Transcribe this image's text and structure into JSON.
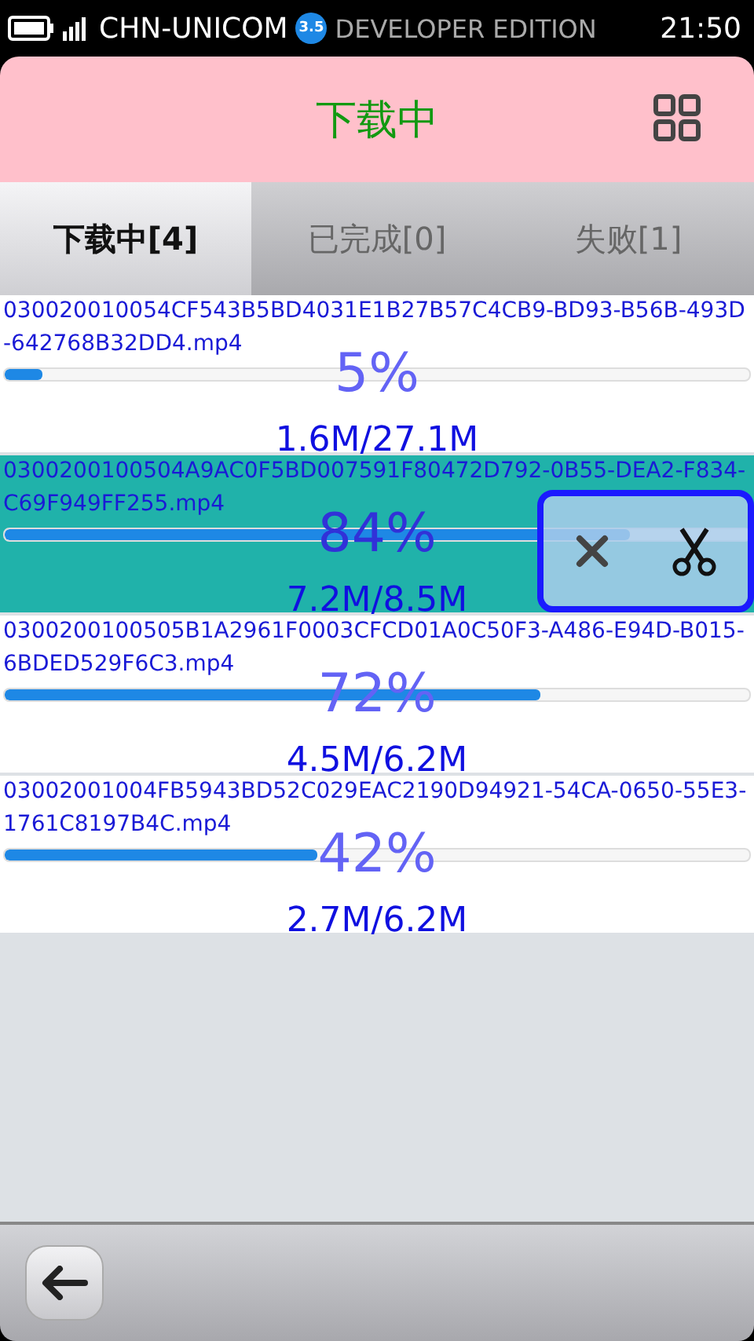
{
  "status_bar": {
    "carrier": "CHN-UNICOM",
    "edition": "DEVELOPER EDITION",
    "version_badge": "3.5",
    "time": "21:50"
  },
  "header": {
    "title": "下载中"
  },
  "tabs": [
    {
      "label": "下载中[4]",
      "selected": true
    },
    {
      "label": "已完成[0]",
      "selected": false
    },
    {
      "label": "失败[1]",
      "selected": false
    }
  ],
  "downloads": [
    {
      "filename": "030020010054CF543B5BD4031E1B27B57C4CB9-BD93-B56B-493D-642768B32DD4.mp4",
      "level": 0.05,
      "percent": "5%",
      "size": "1.6M/27.1M",
      "selected": false
    },
    {
      "filename": "0300200100504A9AC0F5BD007591F80472D792-0B55-DEA2-F834-C69F949FF255.mp4",
      "level": 0.84,
      "percent": "84%",
      "size": "7.2M/8.5M",
      "selected": true
    },
    {
      "filename": "0300200100505B1A2961F0003CFCD01A0C50F3-A486-E94D-B015-6BDED529F6C3.mp4",
      "level": 0.72,
      "percent": "72%",
      "size": "4.5M/6.2M",
      "selected": false
    },
    {
      "filename": "03002001004FB5943BD52C029EAC2190D94921-54CA-0650-55E3-1761C8197B4C.mp4",
      "level": 0.42,
      "percent": "42%",
      "size": "2.7M/6.2M",
      "selected": false
    }
  ]
}
